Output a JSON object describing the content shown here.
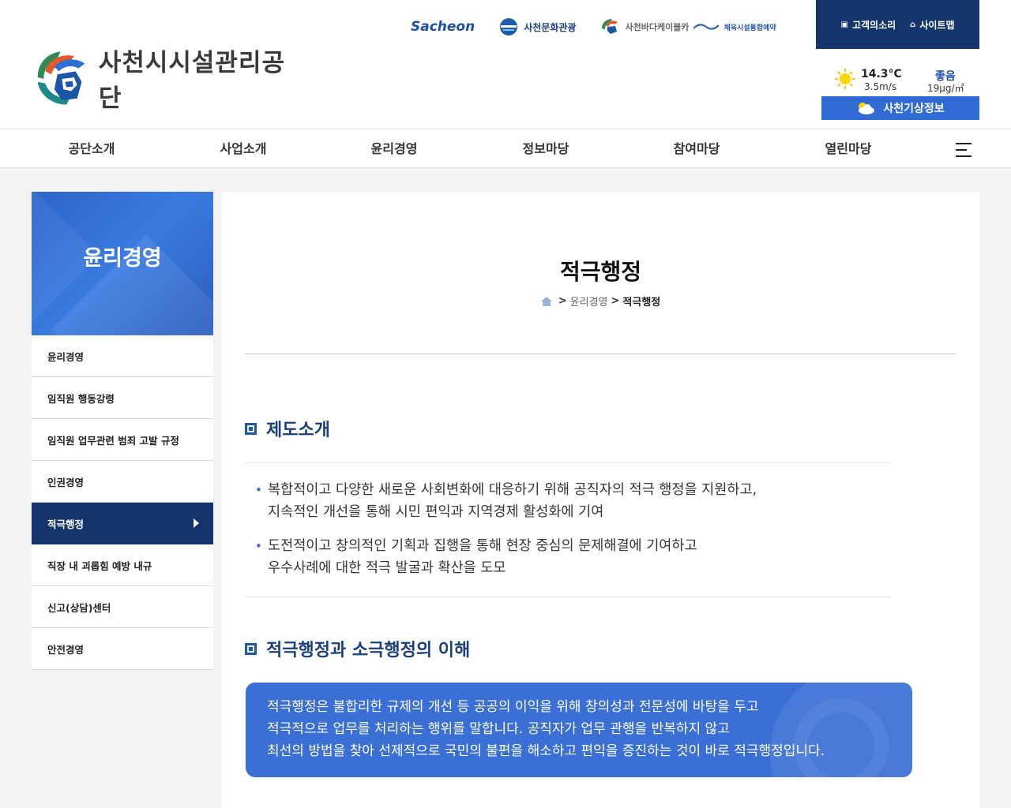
{
  "header": {
    "org_name": "사천시시설관리공단",
    "partners": {
      "sacheon": "Sacheon",
      "culture": "사천문화관광",
      "cablecar": "사천바다케이블카",
      "sports": "체육시설통합예약"
    },
    "utility": {
      "voice": "고객의소리",
      "sitemap": "사이트맵"
    },
    "weather": {
      "temperature": "14.3°C",
      "wind": "3.5m/s",
      "air_status": "좋음",
      "air_value": "19μg/㎥",
      "button_label": "사천기상정보"
    }
  },
  "gnb": {
    "items": [
      "공단소개",
      "사업소개",
      "윤리경영",
      "정보마당",
      "참여마당",
      "열린마당"
    ]
  },
  "side": {
    "title": "윤리경영",
    "items": [
      "윤리경영",
      "임직원 행동강령",
      "임직원 업무관련 범죄 고발 규정",
      "인권경영",
      "적극행정",
      "직장 내 괴롭힘 예방 내규",
      "신고(상담)센터",
      "안전경영"
    ],
    "active_index": 4
  },
  "content": {
    "title": "적극행정",
    "breadcrumb": {
      "sep1": ">",
      "parent": "윤리경영",
      "sep2": ">",
      "current": "적극행정"
    },
    "section1": {
      "heading": "제도소개",
      "bullets": [
        [
          "복합적이고 다양한 새로운 사회변화에 대응하기 위해 공직자의 적극 행정을 지원하고,",
          "지속적인 개선을 통해 시민 편익과 지역경제 활성화에 기여"
        ],
        [
          "도전적이고 창의적인 기획과 집행을 통해 현장 중심의 문제해결에 기여하고",
          "우수사례에 대한 적극 발굴과 확산을 도모"
        ]
      ]
    },
    "section2": {
      "heading": "적극행정과 소극행정의 이해",
      "box_lines": [
        "적극행정은 불합리한 규제의 개선 등 공공의 이익을 위해 창의성과 전문성에 바탕을 두고",
        "적극적으로 업무를 처리하는 행위를 말합니다. 공직자가 업무 관행을 반복하지 않고",
        "최선의 방법을 찾아 선제적으로 국민의 불편을 해소하고 편익을 증진하는 것이 바로 적극행정입니다."
      ]
    }
  },
  "colors": {
    "navy": "#13356b",
    "accent_blue": "#2f6ad5",
    "heading_blue": "#1a3f7c"
  }
}
